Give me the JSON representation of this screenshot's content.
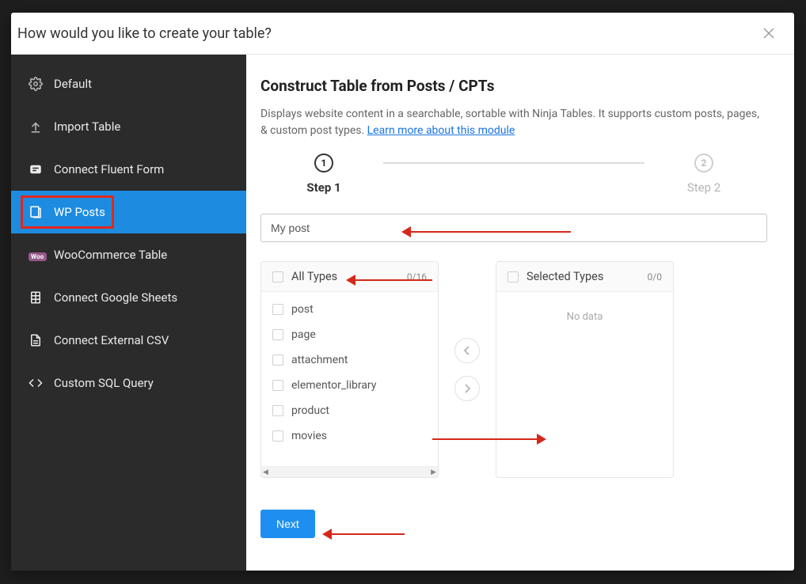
{
  "modal_title": "How would you like to create your table?",
  "sidebar": {
    "items": [
      {
        "label": "Default",
        "icon": "settings"
      },
      {
        "label": "Import Table",
        "icon": "upload"
      },
      {
        "label": "Connect Fluent Form",
        "icon": "form"
      },
      {
        "label": "WP Posts",
        "icon": "wp-posts",
        "active": true
      },
      {
        "label": "WooCommerce Table",
        "icon": "woo"
      },
      {
        "label": "Connect Google Sheets",
        "icon": "sheets"
      },
      {
        "label": "Connect External CSV",
        "icon": "document"
      },
      {
        "label": "Custom SQL Query",
        "icon": "code"
      }
    ]
  },
  "main": {
    "heading": "Construct Table from Posts / CPTs",
    "description": "Displays website content in a searchable, sortable with Ninja Tables. It supports custom posts, pages, & custom post types. ",
    "learn_more": "Learn more about this module",
    "steps": [
      {
        "num": "1",
        "label": "Step 1",
        "active": true
      },
      {
        "num": "2",
        "label": "Step 2",
        "active": false
      }
    ],
    "title_input_value": "My post",
    "title_input_placeholder": "My post",
    "all_types": {
      "title": "All Types",
      "count": "0/16",
      "items": [
        "post",
        "page",
        "attachment",
        "elementor_library",
        "product",
        "movies"
      ]
    },
    "selected_types": {
      "title": "Selected Types",
      "count": "0/0",
      "empty_text": "No data"
    },
    "next_label": "Next"
  }
}
